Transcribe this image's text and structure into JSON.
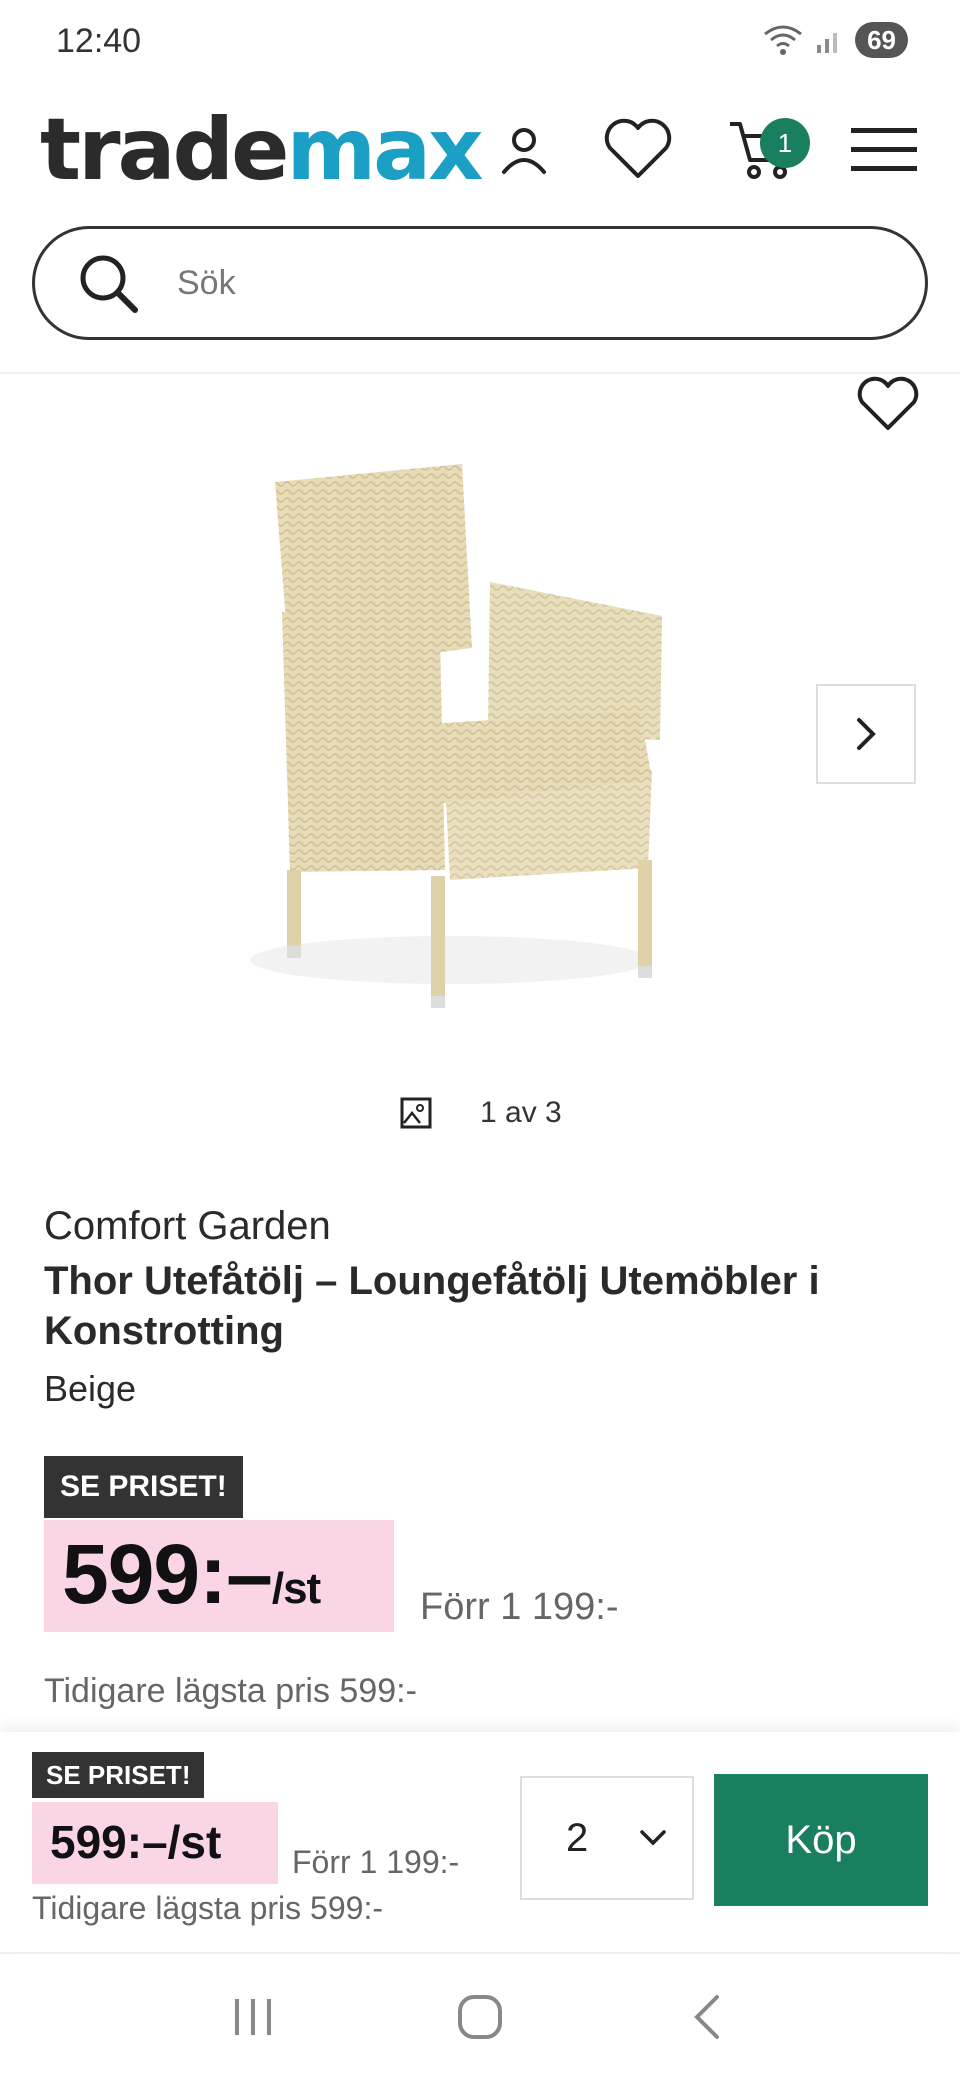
{
  "status_bar": {
    "time": "12:40",
    "battery": "69"
  },
  "header": {
    "logo_part1": "trade",
    "logo_part2": "max",
    "cart_count": "1",
    "icons": [
      "account-icon",
      "heart-icon",
      "cart-icon",
      "menu-icon"
    ]
  },
  "search": {
    "placeholder": "Sök"
  },
  "gallery": {
    "counter": "1 av 3"
  },
  "product": {
    "brand": "Comfort Garden",
    "title": "Thor Utefåtölj – Loungefåtölj Utemöbler i Konstrotting",
    "color": "Beige",
    "badge": "SE PRISET!",
    "price": "599:–",
    "price_unit": "/st",
    "old_price": "Förr 1 199:-",
    "lowest_price": "Tidigare lägsta pris 599:-"
  },
  "sticky": {
    "badge": "SE PRISET!",
    "price": "599:–/st",
    "old_price": "Förr 1 199:-",
    "lowest_price": "Tidigare lägsta pris 599:-",
    "quantity": "2",
    "buy_label": "Köp"
  },
  "colors": {
    "accent_green": "#1a7f5f",
    "logo_blue": "#1b9fc4",
    "price_pink": "#f9d5e5"
  }
}
